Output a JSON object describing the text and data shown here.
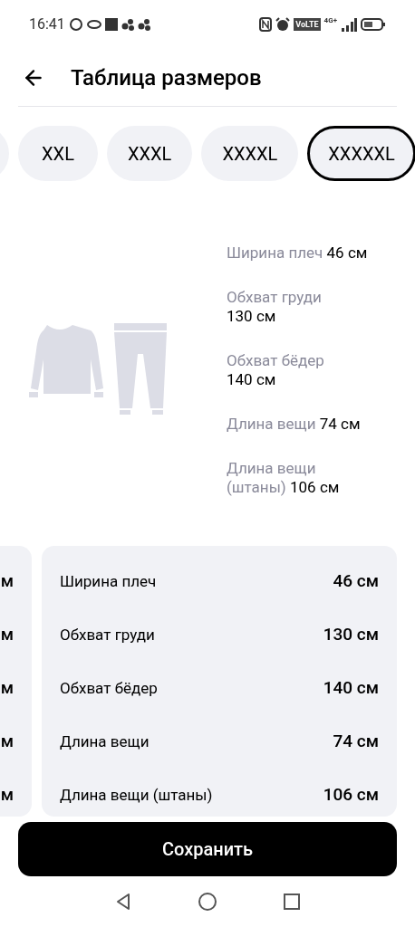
{
  "status_bar": {
    "time": "16:41",
    "network_badge": "VoLTE",
    "network_type": "4G+"
  },
  "header": {
    "title": "Таблица размеров"
  },
  "sizes": [
    {
      "selected": false
    },
    {
      "label": "XXL",
      "selected": false
    },
    {
      "label": "XXXL",
      "selected": false
    },
    {
      "label": "XXXXL",
      "selected": false
    },
    {
      "label": "XXXXXL",
      "selected": true
    }
  ],
  "figure_measurements": [
    {
      "label": "Ширина плеч",
      "value": "46 см"
    },
    {
      "label": "Обхват груди",
      "value": "130 см"
    },
    {
      "label": "Обхват бёдер",
      "value": "140 см"
    },
    {
      "label": "Длина вещи",
      "value": "74 см"
    },
    {
      "label": "Длина вещи (штаны)",
      "value": "106 см"
    }
  ],
  "previous_card": {
    "values": [
      "м",
      "м",
      "м",
      "м",
      "м"
    ]
  },
  "size_card": {
    "rows": [
      {
        "label": "Ширина плеч",
        "value": "46 см"
      },
      {
        "label": "Обхват груди",
        "value": "130 см"
      },
      {
        "label": "Обхват бёдер",
        "value": "140 см"
      },
      {
        "label": "Длина вещи",
        "value": "74 см"
      },
      {
        "label": "Длина вещи (штаны)",
        "value": "106 см"
      }
    ]
  },
  "save_button": {
    "label": "Сохранить"
  }
}
